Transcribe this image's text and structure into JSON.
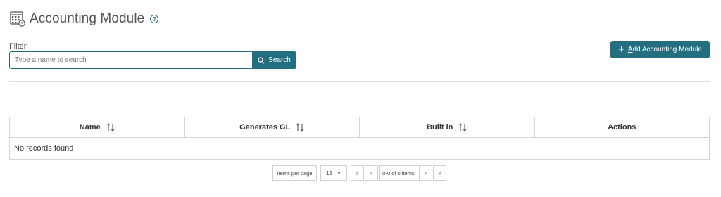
{
  "header": {
    "title": "Accounting Module",
    "help_glyph": "?"
  },
  "filter": {
    "label": "Filter",
    "search_placeholder": "Type a name to search",
    "search_button": "Search"
  },
  "actions": {
    "add_button_first": "A",
    "add_button_rest": "dd Accounting Module"
  },
  "table": {
    "columns": [
      {
        "label": "Name",
        "sortable": true
      },
      {
        "label": "Generates GL",
        "sortable": true
      },
      {
        "label": "Built in",
        "sortable": true
      },
      {
        "label": "Actions",
        "sortable": false
      }
    ],
    "empty_message": "No records found"
  },
  "pagination": {
    "items_per_page_label": "Items per page",
    "page_size": "15",
    "info": "0-0 of 0 items",
    "first": "«",
    "prev": "‹",
    "next": "›",
    "last": "»"
  },
  "colors": {
    "accent": "#236f80",
    "border": "#d6d6d6"
  }
}
